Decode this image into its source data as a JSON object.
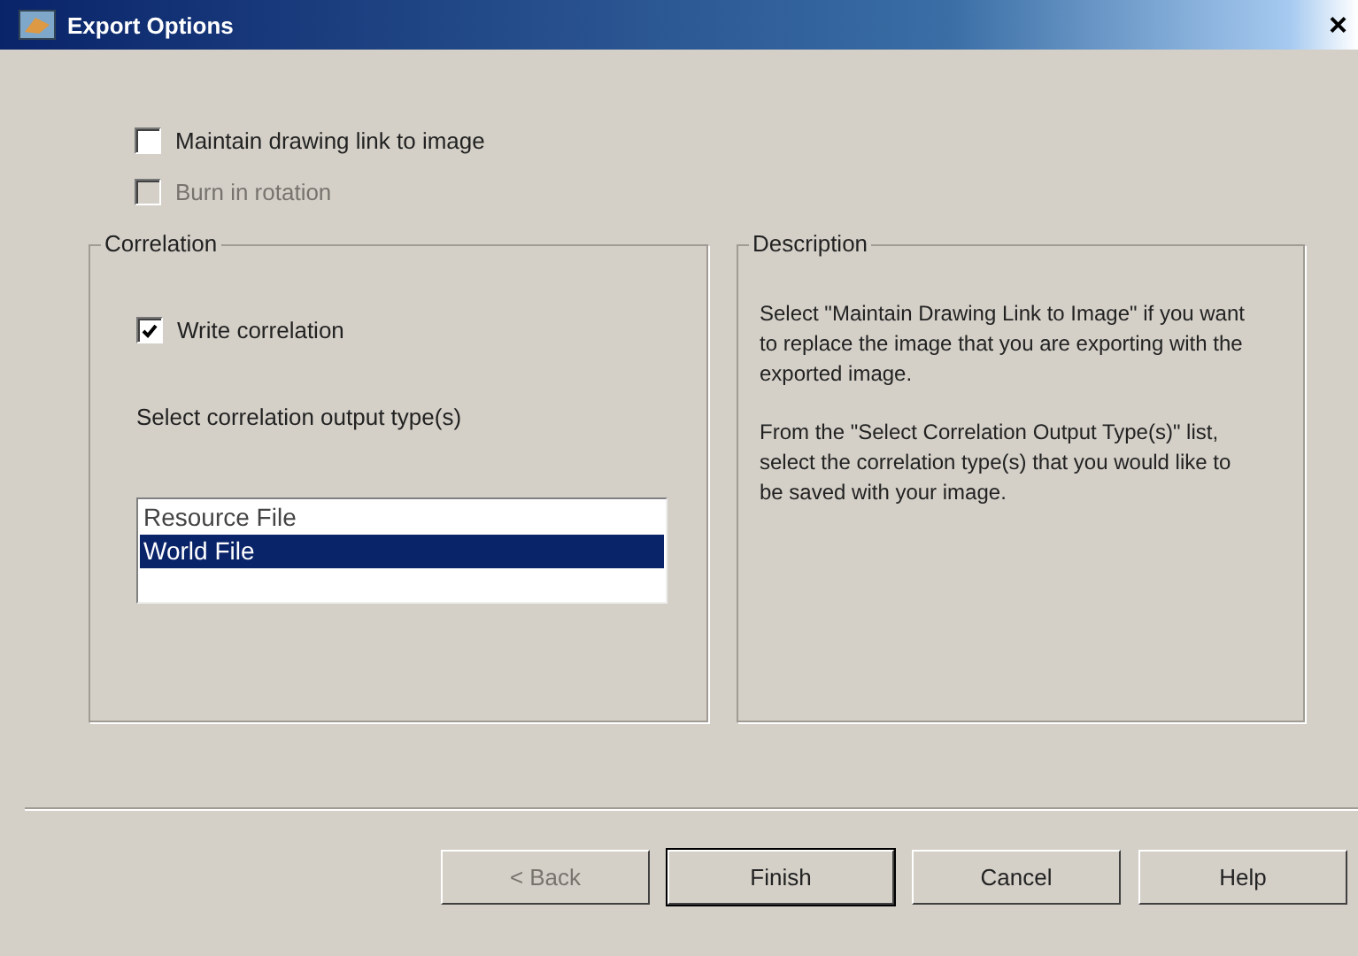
{
  "window": {
    "title": "Export Options",
    "close": "×"
  },
  "options": [
    {
      "label": "Maintain drawing link to image",
      "checked": false,
      "disabled": false
    },
    {
      "label": "Burn in rotation",
      "checked": false,
      "disabled": true
    }
  ],
  "correlation": {
    "title": "Correlation",
    "write": {
      "label": "Write correlation",
      "checked": true
    },
    "list_label": "Select correlation output type(s)",
    "items": [
      {
        "label": "Resource File",
        "selected": false
      },
      {
        "label": "World File",
        "selected": true
      }
    ]
  },
  "description": {
    "title": "Description",
    "paragraphs": [
      "Select \"Maintain Drawing Link to Image\" if you want to replace the image that you are exporting with the exported image.",
      "From the \"Select Correlation Output Type(s)\" list, select the correlation type(s) that you would like to be saved with your image."
    ]
  },
  "buttons": [
    {
      "label": "< Back",
      "disabled": true,
      "default": false
    },
    {
      "label": "Finish",
      "disabled": false,
      "default": true
    },
    {
      "label": "Cancel",
      "disabled": false,
      "default": false
    },
    {
      "label": "Help",
      "disabled": false,
      "default": false
    }
  ]
}
